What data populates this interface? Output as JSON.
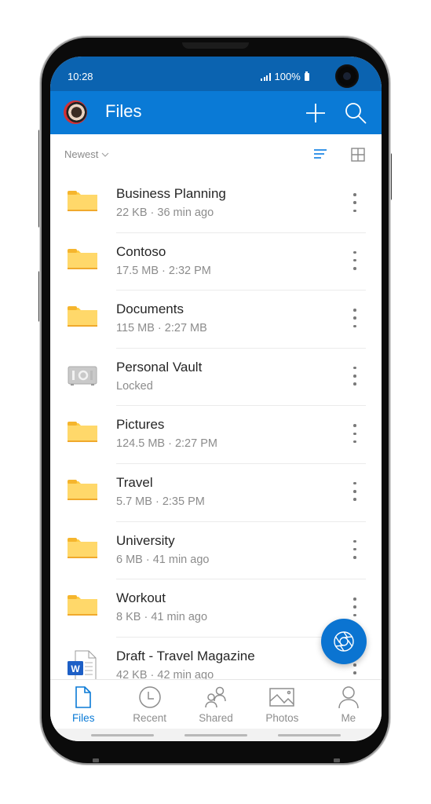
{
  "status_bar": {
    "time": "10:28",
    "battery": "100%"
  },
  "app_bar": {
    "title": "Files",
    "avatar_alt": "User avatar"
  },
  "sort": {
    "label": "Newest",
    "active_view": "list"
  },
  "files": [
    {
      "name": "Business Planning",
      "meta": "22 KB · 36 min ago",
      "icon": "folder-icon"
    },
    {
      "name": "Contoso",
      "meta": "17.5 MB · 2:32 PM",
      "icon": "folder-icon"
    },
    {
      "name": "Documents",
      "meta": "115 MB · 2:27 MB",
      "icon": "folder-icon"
    },
    {
      "name": "Personal Vault",
      "meta": "Locked",
      "icon": "vault-icon"
    },
    {
      "name": "Pictures",
      "meta": "124.5 MB · 2:27 PM",
      "icon": "folder-icon"
    },
    {
      "name": "Travel",
      "meta": "5.7 MB · 2:35 PM",
      "icon": "folder-icon"
    },
    {
      "name": "University",
      "meta": "6 MB · 41 min ago",
      "icon": "folder-icon"
    },
    {
      "name": "Workout",
      "meta": "8 KB · 41 min ago",
      "icon": "folder-icon"
    },
    {
      "name": "Draft - Travel Magazine",
      "meta": "42 KB · 42 min ago",
      "icon": "word-doc-icon"
    }
  ],
  "bottom_nav": [
    {
      "label": "Files",
      "icon": "file-icon",
      "active": true
    },
    {
      "label": "Recent",
      "icon": "clock-icon",
      "active": false
    },
    {
      "label": "Shared",
      "icon": "people-icon",
      "active": false
    },
    {
      "label": "Photos",
      "icon": "image-icon",
      "active": false
    },
    {
      "label": "Me",
      "icon": "person-icon",
      "active": false
    }
  ],
  "colors": {
    "status_bar": "#0b63b0",
    "app_bar": "#0a7ad6",
    "accent": "#0a7ad6",
    "folder": "#ffd257"
  }
}
